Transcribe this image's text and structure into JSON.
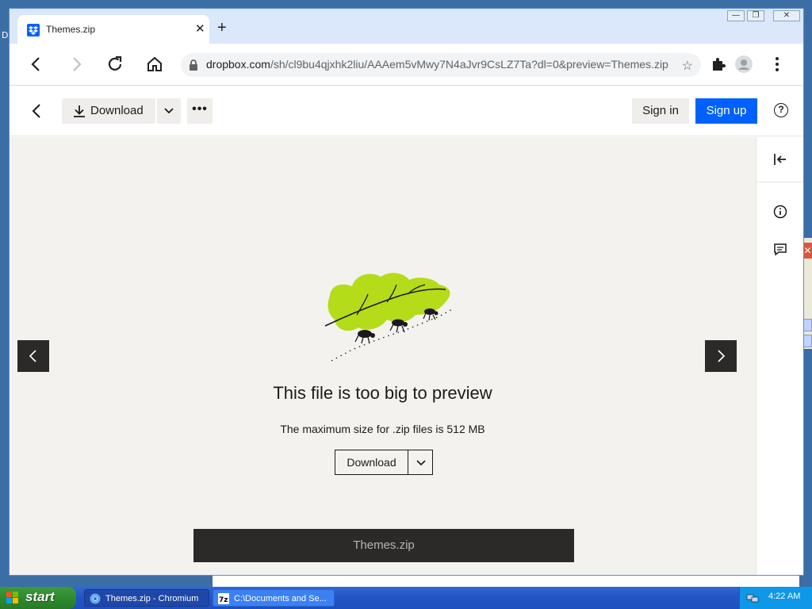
{
  "desktop": {
    "letter": "D"
  },
  "browser": {
    "tab": {
      "title": "Themes.zip",
      "close_glyph": "✕"
    },
    "new_tab_glyph": "+",
    "url": {
      "host": "dropbox.com",
      "path": "/sh/cl9bu4qjxhk2liu/AAAem5vMwy7N4aJvr9CsLZ7Ta?dl=0&preview=Themes.zip"
    },
    "window_controls": [
      "—",
      "❐",
      "✕"
    ]
  },
  "dropbox": {
    "download_label": "Download",
    "more_label": "•••",
    "signin_label": "Sign in",
    "signup_label": "Sign up",
    "help_label": "?",
    "headline": "This file is too big to preview",
    "subline": "The maximum size for .zip files is 512 MB",
    "download2_label": "Download",
    "file_name": "Themes.zip",
    "colors": {
      "accent": "#0061fe",
      "leaf": "#b4dc19",
      "dark": "#2b2a28"
    }
  },
  "taskbar": {
    "start_label": "start",
    "tasks": [
      {
        "label": "Themes.zip - Chromium",
        "active": true
      },
      {
        "label": "C:\\Documents and Se...",
        "active": false
      }
    ],
    "clock": "4:22 AM"
  }
}
